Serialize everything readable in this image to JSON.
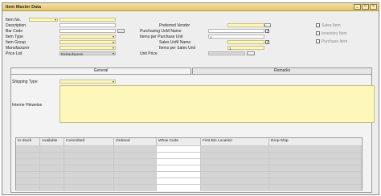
{
  "window": {
    "title": "Item Master Data",
    "controls": [
      "_",
      "□",
      "×"
    ]
  },
  "left_form": [
    {
      "key": "item_no",
      "label": "Item No.",
      "value": "",
      "kind": "dropdown-text"
    },
    {
      "key": "description",
      "label": "Description",
      "value": ""
    },
    {
      "key": "bar_code",
      "label": "Bar Code",
      "value": ""
    },
    {
      "key": "item_type",
      "label": "Item Type",
      "value": "",
      "kind": "dropdown"
    },
    {
      "key": "item_group",
      "label": "Item Group",
      "value": "",
      "kind": "dropdown"
    },
    {
      "key": "manufacturer",
      "label": "Manufacturer",
      "value": "",
      "kind": "dropdown"
    },
    {
      "key": "price_list",
      "label": "Price List",
      "value": "Einkaufspreis",
      "kind": "dropdown"
    }
  ],
  "right_form": {
    "preferred_vendor": {
      "label": "Preferred Vendor",
      "value": ""
    },
    "purchasing_uom_name": {
      "label": "Purchasing UoM Name",
      "value": ""
    },
    "items_per_purchase_unit": {
      "label": "Items per Purchase Unit",
      "value": "1"
    },
    "sales_uom_name": {
      "label": "Sales UoM Name",
      "value": ""
    },
    "items_per_sales_unit": {
      "label": "Items per Sales Unit",
      "value": "1"
    },
    "unit_price": {
      "label": "Unit Price",
      "value": ""
    }
  },
  "checkboxes": {
    "sales_item": {
      "label": "Sales Item",
      "checked": false
    },
    "inventory_item": {
      "label": "Inventory Item",
      "checked": false
    },
    "purchase_item": {
      "label": "Purchase Item",
      "checked": false
    }
  },
  "tabs": [
    {
      "label": "General",
      "active": true
    },
    {
      "label": "Remarks",
      "active": false
    }
  ],
  "general": {
    "shipping_type": {
      "label": "Shipping Type",
      "value": ""
    },
    "interne_hinweise": {
      "label": "Interne Hinweise",
      "value": ""
    }
  },
  "stock_table": {
    "columns": [
      "In Stock",
      "Available",
      "Committed",
      "Ordered",
      "Whse Code",
      "First Bin Location",
      "Drop-Ship"
    ],
    "rows": [
      [
        "",
        "",
        "",
        "",
        "",
        "",
        ""
      ],
      [
        "",
        "",
        "",
        "",
        "",
        "",
        ""
      ],
      [
        "",
        "",
        "",
        "",
        "",
        "",
        ""
      ],
      [
        "",
        "",
        "",
        "",
        "",
        "",
        ""
      ],
      [
        "",
        "",
        "",
        "",
        "",
        "",
        ""
      ],
      [
        "",
        "",
        "",
        "",
        "",
        "",
        ""
      ],
      [
        "",
        "",
        "",
        "",
        "",
        "",
        ""
      ]
    ]
  },
  "colors": {
    "titlebar": "#e2c56a",
    "mandatory_field": "#fdf7b9",
    "readonly_field": "#d6d6d6",
    "window_bg": "#eeeeee"
  }
}
